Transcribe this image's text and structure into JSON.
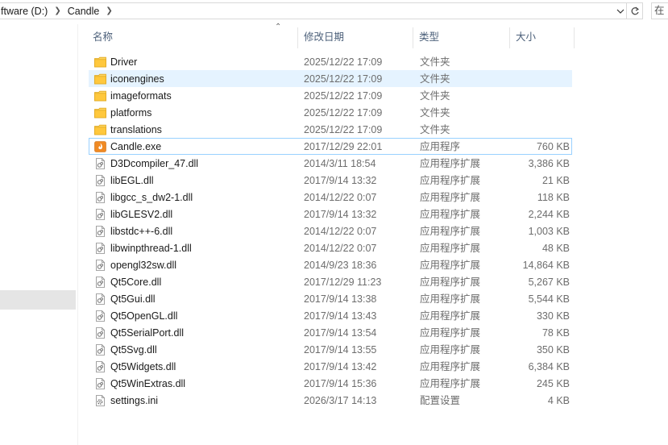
{
  "address": {
    "crumbs": [
      "ftware (D:)",
      "Candle"
    ],
    "search_placeholder": "在"
  },
  "columns": {
    "name": "名称",
    "date": "修改日期",
    "type": "类型",
    "size": "大小"
  },
  "files": [
    {
      "name": "Driver",
      "date": "2025/12/22 17:09",
      "type": "文件夹",
      "size": "",
      "icon": "folder-icon"
    },
    {
      "name": "iconengines",
      "date": "2025/12/22 17:09",
      "type": "文件夹",
      "size": "",
      "icon": "folder-icon"
    },
    {
      "name": "imageformats",
      "date": "2025/12/22 17:09",
      "type": "文件夹",
      "size": "",
      "icon": "folder-icon"
    },
    {
      "name": "platforms",
      "date": "2025/12/22 17:09",
      "type": "文件夹",
      "size": "",
      "icon": "folder-icon"
    },
    {
      "name": "translations",
      "date": "2025/12/22 17:09",
      "type": "文件夹",
      "size": "",
      "icon": "folder-icon"
    },
    {
      "name": "Candle.exe",
      "date": "2017/12/29 22:01",
      "type": "应用程序",
      "size": "760 KB",
      "icon": "candle-app-icon"
    },
    {
      "name": "D3Dcompiler_47.dll",
      "date": "2014/3/11 18:54",
      "type": "应用程序扩展",
      "size": "3,386 KB",
      "icon": "dll-file-icon"
    },
    {
      "name": "libEGL.dll",
      "date": "2017/9/14 13:32",
      "type": "应用程序扩展",
      "size": "21 KB",
      "icon": "dll-file-icon"
    },
    {
      "name": "libgcc_s_dw2-1.dll",
      "date": "2014/12/22 0:07",
      "type": "应用程序扩展",
      "size": "118 KB",
      "icon": "dll-file-icon"
    },
    {
      "name": "libGLESV2.dll",
      "date": "2017/9/14 13:32",
      "type": "应用程序扩展",
      "size": "2,244 KB",
      "icon": "dll-file-icon"
    },
    {
      "name": "libstdc++-6.dll",
      "date": "2014/12/22 0:07",
      "type": "应用程序扩展",
      "size": "1,003 KB",
      "icon": "dll-file-icon"
    },
    {
      "name": "libwinpthread-1.dll",
      "date": "2014/12/22 0:07",
      "type": "应用程序扩展",
      "size": "48 KB",
      "icon": "dll-file-icon"
    },
    {
      "name": "opengl32sw.dll",
      "date": "2014/9/23 18:36",
      "type": "应用程序扩展",
      "size": "14,864 KB",
      "icon": "dll-file-icon"
    },
    {
      "name": "Qt5Core.dll",
      "date": "2017/12/29 11:23",
      "type": "应用程序扩展",
      "size": "5,267 KB",
      "icon": "dll-file-icon"
    },
    {
      "name": "Qt5Gui.dll",
      "date": "2017/9/14 13:38",
      "type": "应用程序扩展",
      "size": "5,544 KB",
      "icon": "dll-file-icon"
    },
    {
      "name": "Qt5OpenGL.dll",
      "date": "2017/9/14 13:43",
      "type": "应用程序扩展",
      "size": "330 KB",
      "icon": "dll-file-icon"
    },
    {
      "name": "Qt5SerialPort.dll",
      "date": "2017/9/14 13:54",
      "type": "应用程序扩展",
      "size": "78 KB",
      "icon": "dll-file-icon"
    },
    {
      "name": "Qt5Svg.dll",
      "date": "2017/9/14 13:55",
      "type": "应用程序扩展",
      "size": "350 KB",
      "icon": "dll-file-icon"
    },
    {
      "name": "Qt5Widgets.dll",
      "date": "2017/9/14 13:42",
      "type": "应用程序扩展",
      "size": "6,384 KB",
      "icon": "dll-file-icon"
    },
    {
      "name": "Qt5WinExtras.dll",
      "date": "2017/9/14 15:36",
      "type": "应用程序扩展",
      "size": "245 KB",
      "icon": "dll-file-icon"
    },
    {
      "name": "settings.ini",
      "date": "2026/3/17 14:13",
      "type": "配置设置",
      "size": "4 KB",
      "icon": "ini-file-icon"
    }
  ],
  "hover_index": 1,
  "focus_index": 5,
  "colors": {
    "hover": "#e5f3ff",
    "focus_border": "#99d1ff",
    "folder": "#ffd660",
    "header_text": "#4c607a"
  }
}
